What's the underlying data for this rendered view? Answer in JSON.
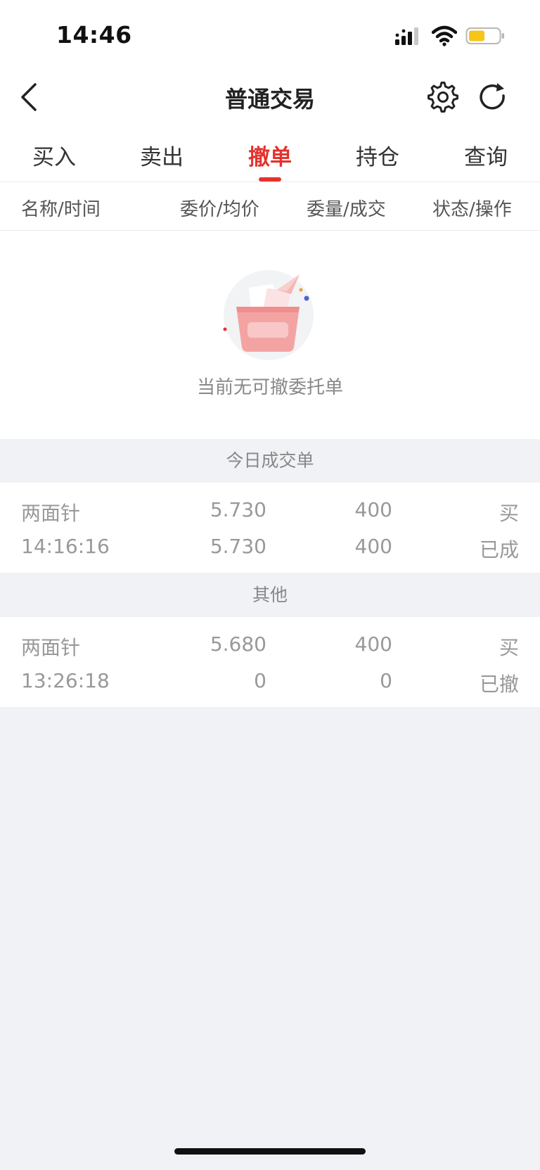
{
  "status_bar": {
    "time": "14:46",
    "battery_color": "#f5c518"
  },
  "nav": {
    "title": "普通交易",
    "icons": [
      "chevron-left-icon",
      "gear-icon",
      "refresh-icon"
    ]
  },
  "tabs": [
    {
      "label": "买入"
    },
    {
      "label": "卖出"
    },
    {
      "label": "撤单",
      "active": true
    },
    {
      "label": "持仓"
    },
    {
      "label": "查询"
    }
  ],
  "columns": [
    "名称/时间",
    "委价/均价",
    "委量/成交",
    "状态/操作"
  ],
  "empty_state": {
    "message": "当前无可撤委托单"
  },
  "sections": [
    {
      "title": "今日成交单",
      "orders": [
        {
          "name": "两面针",
          "time": "14:16:16",
          "order_price": "5.730",
          "avg_price": "5.730",
          "order_qty": "400",
          "filled_qty": "400",
          "side": "买",
          "status": "已成"
        }
      ]
    },
    {
      "title": "其他",
      "orders": [
        {
          "name": "两面针",
          "time": "13:26:18",
          "order_price": "5.680",
          "avg_price": "0",
          "order_qty": "400",
          "filled_qty": "0",
          "side": "买",
          "status": "已撤"
        }
      ]
    }
  ],
  "colors": {
    "accent": "#e5322d",
    "background": "#f1f2f6",
    "muted_text": "#999999"
  }
}
